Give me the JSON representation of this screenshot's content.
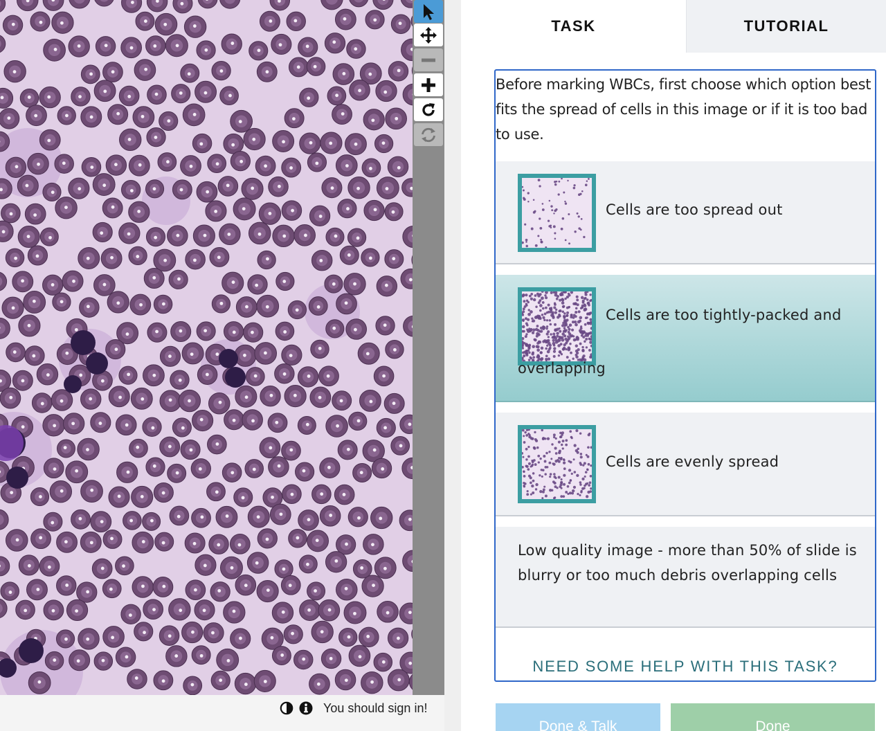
{
  "viewer": {
    "tools": [
      {
        "icon": "pointer-icon",
        "state": "active"
      },
      {
        "icon": "move-icon",
        "state": "normal"
      },
      {
        "icon": "zoom-out-icon",
        "state": "disabled"
      },
      {
        "icon": "zoom-in-icon",
        "state": "normal"
      },
      {
        "icon": "rotate-icon",
        "state": "normal"
      },
      {
        "icon": "reset-icon",
        "state": "disabled"
      }
    ],
    "footer": {
      "invert_icon": "contrast-icon",
      "info_icon": "info-icon",
      "signin_text": "You should sign in!"
    }
  },
  "tabs": {
    "task_label": "TASK",
    "tutorial_label": "TUTORIAL"
  },
  "task": {
    "instructions": "Before marking WBCs, first choose which option best fits the spread of cells in this image or if it is too bad to use.",
    "answers": [
      {
        "label": "Cells are too spread out",
        "thumb": "sparse",
        "selected": false
      },
      {
        "label": "Cells are too tightly-packed and overlapping",
        "thumb": "dense",
        "selected": true
      },
      {
        "label": "Cells are evenly spread",
        "thumb": "even",
        "selected": false
      },
      {
        "label": "Low quality image - more than 50% of slide is blurry or too much debris overlapping cells",
        "thumb": null,
        "selected": false
      }
    ],
    "help_link": "NEED SOME HELP WITH THIS TASK?"
  },
  "buttons": {
    "done_talk": "Done & Talk",
    "done": "Done"
  },
  "colors": {
    "accent_border": "#2f67c9",
    "selected_answer": "#95ccce",
    "thumb_border": "#3c9ea2",
    "help_link": "#2a6e7a",
    "active_tool": "#4b9bd6",
    "done_talk_button": "#a6d4f2",
    "done_button": "#9ecfa8",
    "cell_fill": "#6e4c73",
    "slide_background": "#e1cfe6"
  }
}
